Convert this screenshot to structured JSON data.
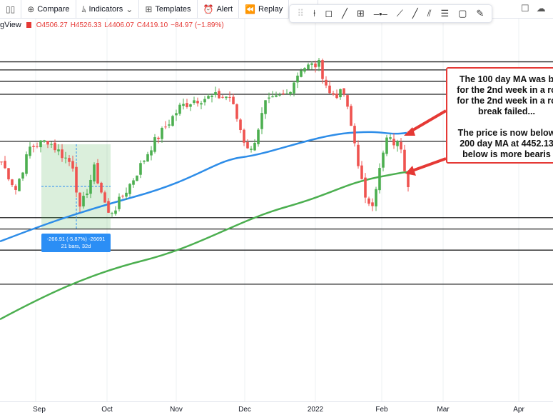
{
  "toolbar": {
    "compare": "Compare",
    "indicators": "Indicators",
    "templates": "Templates",
    "alert": "Alert",
    "replay": "Replay"
  },
  "legend": {
    "symbol_fragment": "gView",
    "open": "O4506.27",
    "high": "H4526.33",
    "low": "L4406.07",
    "close": "C4419.10",
    "change": "−84.97 (−1.89%)"
  },
  "drawing_tools": [
    "cursor-line",
    "callout",
    "trend-line",
    "measure",
    "horizontal-ray",
    "extended-line",
    "ray",
    "parallel-channel",
    "fib",
    "rectangle",
    "brush"
  ],
  "annotation": {
    "lines": [
      "The 100 day MA was b",
      "for the 2nd week in a ro",
      "for the 2nd week in a ro",
      "break failed...",
      "",
      "The price is now below",
      "200 day MA at 4452.13",
      "below is more bearis"
    ]
  },
  "measure": {
    "line1": "-266.91 (-5.87%) -26691",
    "line2": "21 bars, 32d"
  },
  "x_axis": [
    "Sep",
    "Oct",
    "Nov",
    "Dec",
    "2022",
    "Feb",
    "Mar",
    "Apr"
  ],
  "colors": {
    "up": "#26a69a",
    "upFill": "#4caf50",
    "down": "#ef5350",
    "ma100": "#2e8de8",
    "ma200": "#4caf50",
    "arrow": "#e53935"
  },
  "price_path": [
    [
      0,
      4497
    ],
    [
      4,
      4412
    ],
    [
      8,
      4541
    ],
    [
      13,
      4563
    ],
    [
      20,
      4486
    ],
    [
      22,
      4346
    ],
    [
      26,
      4475
    ],
    [
      30,
      4335
    ],
    [
      32,
      4357
    ],
    [
      37,
      4445
    ],
    [
      42,
      4545
    ],
    [
      50,
      4665
    ],
    [
      54,
      4688
    ],
    [
      60,
      4698
    ],
    [
      64,
      4698
    ],
    [
      68,
      4563
    ],
    [
      70,
      4530
    ],
    [
      74,
      4676
    ],
    [
      80,
      4706
    ],
    [
      84,
      4787
    ],
    [
      89,
      4797
    ],
    [
      92,
      4706
    ],
    [
      96,
      4706
    ],
    [
      99,
      4555
    ],
    [
      102,
      4375
    ],
    [
      104,
      4375
    ],
    [
      106,
      4472
    ],
    [
      108,
      4567
    ],
    [
      112,
      4545
    ],
    [
      114,
      4419
    ]
  ],
  "horizontal_levels": [
    4805,
    4780,
    4745,
    4705,
    4560,
    4325,
    4290,
    4225,
    4120
  ]
}
